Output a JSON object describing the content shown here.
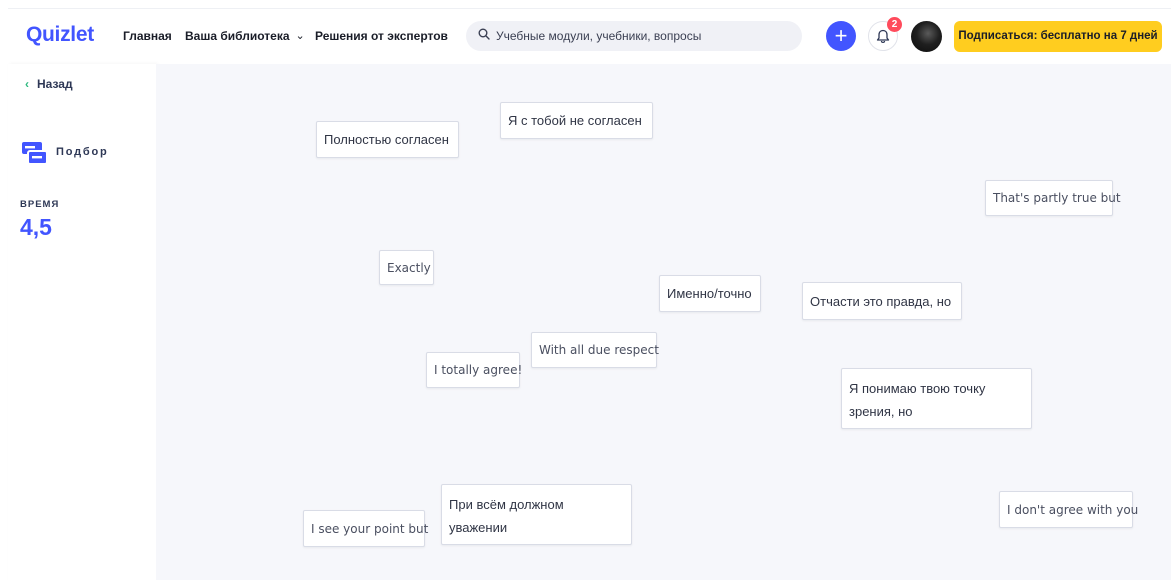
{
  "header": {
    "logo": "Quizlet",
    "nav_home": "Главная",
    "nav_library": "Ваша библиотека",
    "nav_experts": "Решения от экспертов",
    "search_placeholder": "Учебные модули, учебники, вопросы",
    "notifications_count": "2",
    "subscribe_label": "Подписаться: бесплатно на 7 дней",
    "accent_color": "#4255ff",
    "subscribe_color": "#ffcd1f"
  },
  "sidebar": {
    "back_label": "Назад",
    "mode_label": "Подбор",
    "time_label": "ВРЕМЯ",
    "time_value": "4,5"
  },
  "cards": [
    {
      "text": "Полностью согласен",
      "lang": "ru"
    },
    {
      "text": "Я с тобой не согласен",
      "lang": "ru"
    },
    {
      "text": "That's partly true but",
      "lang": "en"
    },
    {
      "text": "Exactly",
      "lang": "en"
    },
    {
      "text": "Именно/точно",
      "lang": "ru"
    },
    {
      "text": "Отчасти это правда, но",
      "lang": "ru"
    },
    {
      "text": "With all due respect",
      "lang": "en"
    },
    {
      "text": "I totally agree!",
      "lang": "en"
    },
    {
      "text": "Я понимаю твою точку зрения, но",
      "lang": "ru"
    },
    {
      "text": "При всём должном уважении",
      "lang": "ru"
    },
    {
      "text": "I see your point but",
      "lang": "en"
    },
    {
      "text": "I don't agree with you",
      "lang": "en"
    }
  ]
}
